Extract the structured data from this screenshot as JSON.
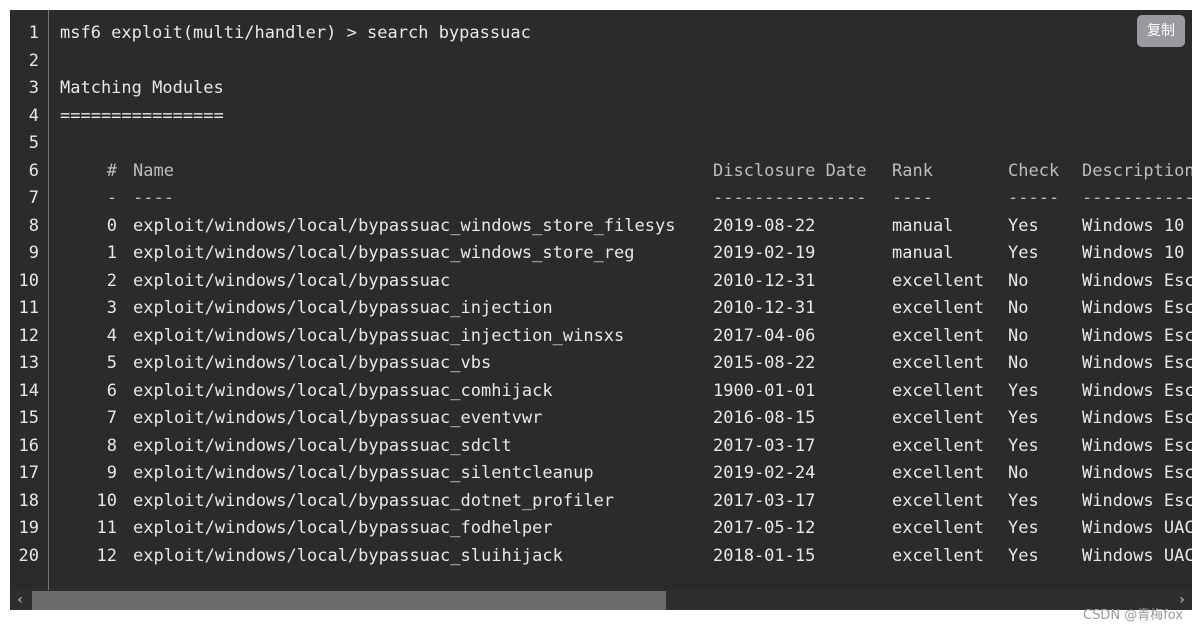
{
  "terminal": {
    "command_line": "msf6 exploit(multi/handler) > search bypassuac",
    "blank_line": "",
    "heading": "Matching Modules",
    "heading_underline": "================",
    "table": {
      "headers": [
        "#",
        "Name",
        "Disclosure Date",
        "Rank",
        "Check",
        "Description"
      ],
      "separators": [
        "-",
        "----",
        "---------------",
        "----",
        "-----",
        "-----------"
      ],
      "rows": [
        [
          "0",
          "exploit/windows/local/bypassuac_windows_store_filesys",
          "2019-08-22",
          "manual",
          "Yes",
          "Windows 10"
        ],
        [
          "1",
          "exploit/windows/local/bypassuac_windows_store_reg",
          "2019-02-19",
          "manual",
          "Yes",
          "Windows 10"
        ],
        [
          "2",
          "exploit/windows/local/bypassuac",
          "2010-12-31",
          "excellent",
          "No",
          "Windows Esc"
        ],
        [
          "3",
          "exploit/windows/local/bypassuac_injection",
          "2010-12-31",
          "excellent",
          "No",
          "Windows Esc"
        ],
        [
          "4",
          "exploit/windows/local/bypassuac_injection_winsxs",
          "2017-04-06",
          "excellent",
          "No",
          "Windows Esc"
        ],
        [
          "5",
          "exploit/windows/local/bypassuac_vbs",
          "2015-08-22",
          "excellent",
          "No",
          "Windows Esc"
        ],
        [
          "6",
          "exploit/windows/local/bypassuac_comhijack",
          "1900-01-01",
          "excellent",
          "Yes",
          "Windows Esc"
        ],
        [
          "7",
          "exploit/windows/local/bypassuac_eventvwr",
          "2016-08-15",
          "excellent",
          "Yes",
          "Windows Esc"
        ],
        [
          "8",
          "exploit/windows/local/bypassuac_sdclt",
          "2017-03-17",
          "excellent",
          "Yes",
          "Windows Esc"
        ],
        [
          "9",
          "exploit/windows/local/bypassuac_silentcleanup",
          "2019-02-24",
          "excellent",
          "No",
          "Windows Esc"
        ],
        [
          "10",
          "exploit/windows/local/bypassuac_dotnet_profiler",
          "2017-03-17",
          "excellent",
          "Yes",
          "Windows Esc"
        ],
        [
          "11",
          "exploit/windows/local/bypassuac_fodhelper",
          "2017-05-12",
          "excellent",
          "Yes",
          "Windows UAC"
        ],
        [
          "12",
          "exploit/windows/local/bypassuac_sluihijack",
          "2018-01-15",
          "excellent",
          "Yes",
          "Windows UAC"
        ]
      ]
    },
    "line_numbers": [
      "1",
      "2",
      "3",
      "4",
      "5",
      "6",
      "7",
      "8",
      "9",
      "10",
      "11",
      "12",
      "13",
      "14",
      "15",
      "16",
      "17",
      "18",
      "19",
      "20"
    ]
  },
  "toolbar": {
    "copy_label": "复制"
  },
  "scrollbar": {
    "left_arrow": "‹",
    "right_arrow": "›",
    "thumb_fraction": 0.54
  },
  "watermark": "CSDN @青梅fox",
  "colors": {
    "background": "#2b2b2b",
    "text": "#e8e8e8",
    "copy_button": "#9a9a9f"
  }
}
